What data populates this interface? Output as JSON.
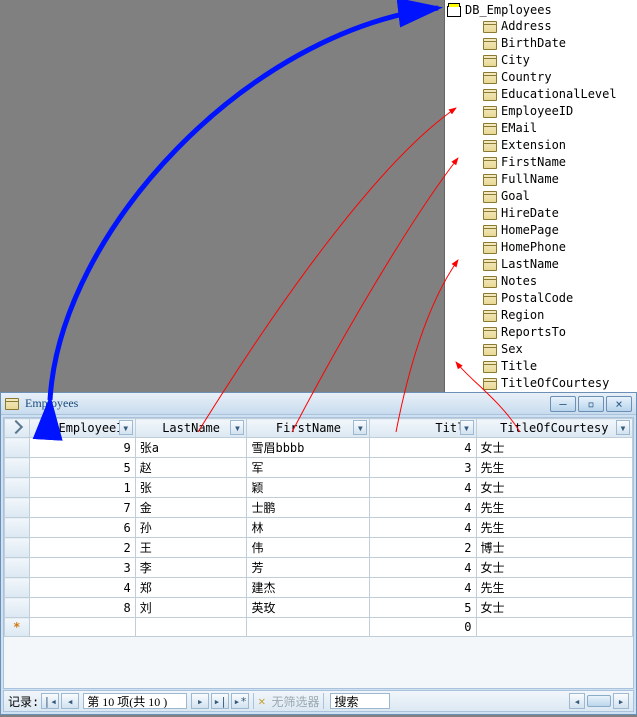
{
  "tree": {
    "root": "DB_Employees",
    "fields": [
      "Address",
      "BirthDate",
      "City",
      "Country",
      "EducationalLevel",
      "EmployeeID",
      "EMail",
      "Extension",
      "FirstName",
      "FullName",
      "Goal",
      "HireDate",
      "HomePage",
      "HomePhone",
      "LastName",
      "Notes",
      "PostalCode",
      "Region",
      "ReportsTo",
      "Sex",
      "Title",
      "TitleOfCourtesy"
    ]
  },
  "datasheet": {
    "title": "Employees",
    "columns": [
      "EmployeeID",
      "LastName",
      "FirstName",
      "Title",
      "TitleOfCourtesy"
    ],
    "sel_header": "",
    "rows": [
      {
        "EmployeeID": "9",
        "LastName": "张a",
        "FirstName": "雪眉bbbb",
        "Title": "4",
        "TitleOfCourtesy": "女士"
      },
      {
        "EmployeeID": "5",
        "LastName": "赵",
        "FirstName": "军",
        "Title": "3",
        "TitleOfCourtesy": "先生"
      },
      {
        "EmployeeID": "1",
        "LastName": "张",
        "FirstName": "颖",
        "Title": "4",
        "TitleOfCourtesy": "女士"
      },
      {
        "EmployeeID": "7",
        "LastName": "金",
        "FirstName": "士鹏",
        "Title": "4",
        "TitleOfCourtesy": "先生"
      },
      {
        "EmployeeID": "6",
        "LastName": "孙",
        "FirstName": "林",
        "Title": "4",
        "TitleOfCourtesy": "先生"
      },
      {
        "EmployeeID": "2",
        "LastName": "王",
        "FirstName": "伟",
        "Title": "2",
        "TitleOfCourtesy": "博士"
      },
      {
        "EmployeeID": "3",
        "LastName": "李",
        "FirstName": "芳",
        "Title": "4",
        "TitleOfCourtesy": "女士"
      },
      {
        "EmployeeID": "4",
        "LastName": "郑",
        "FirstName": "建杰",
        "Title": "4",
        "TitleOfCourtesy": "先生"
      },
      {
        "EmployeeID": "8",
        "LastName": "刘",
        "FirstName": "英玫",
        "Title": "5",
        "TitleOfCourtesy": "女士"
      }
    ],
    "new_row_title": "0",
    "nav": {
      "label": "记录:",
      "pos": "第 10 项(共 10 )",
      "filter": "无筛选器",
      "search": "搜索"
    }
  }
}
